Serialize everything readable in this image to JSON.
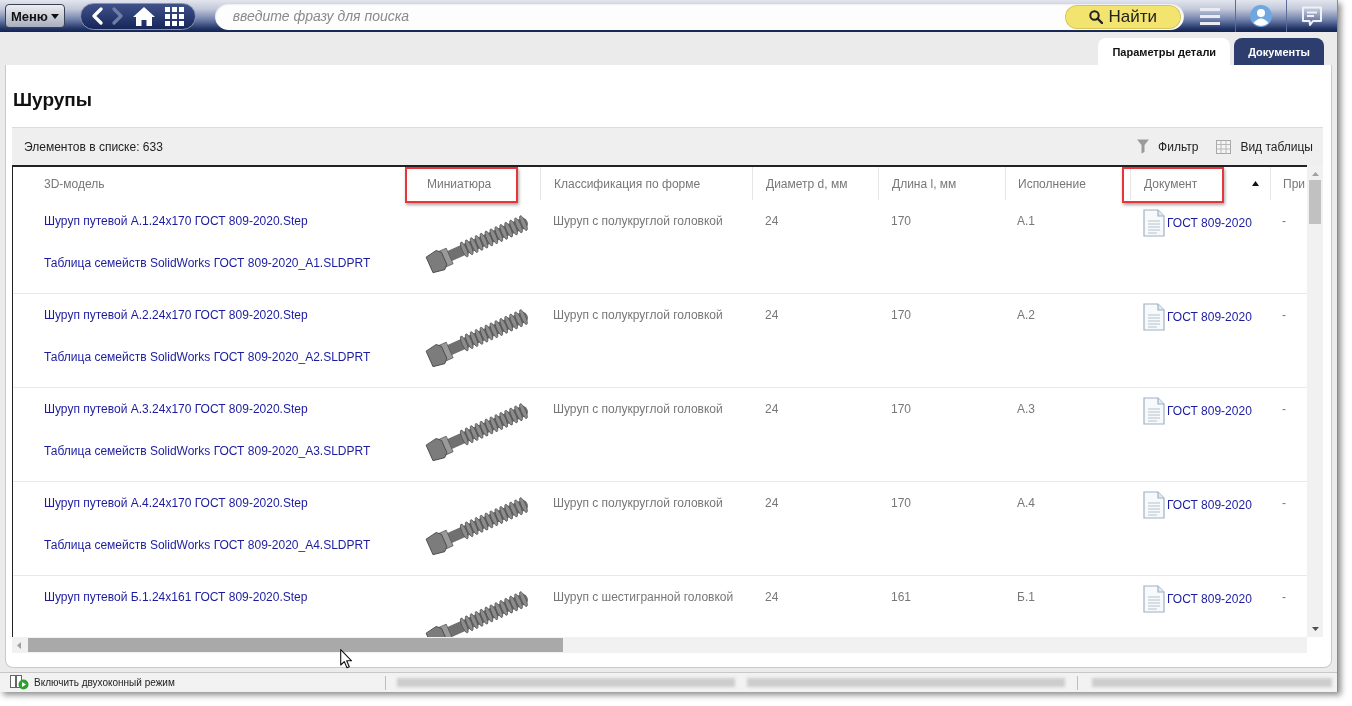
{
  "top_bar": {
    "menu_label": "Меню",
    "nav_buttons": [
      {
        "kind": "back",
        "disabled": false
      },
      {
        "kind": "forward",
        "disabled": true
      },
      {
        "kind": "home",
        "disabled": false
      },
      {
        "kind": "apps",
        "disabled": false
      }
    ],
    "search": {
      "placeholder": "введите фразу для поиска",
      "button_label": "Найти"
    }
  },
  "tabs": [
    {
      "label": "Параметры детали",
      "selected": true
    },
    {
      "label": "Документы",
      "selected": false
    }
  ],
  "page_title": "Шурупы",
  "toolbar": {
    "count": "Элементов в списке: 633",
    "actions": [
      {
        "kind": "filter",
        "label": "Фильтр"
      },
      {
        "kind": "table_view",
        "label": "Вид таблицы"
      }
    ]
  },
  "table": {
    "columns": [
      {
        "label": "3D-модель",
        "highlighted": false,
        "sorted": false
      },
      {
        "label": "Миниатюра",
        "highlighted": true,
        "sorted": false
      },
      {
        "label": "Классификация по форме",
        "highlighted": false,
        "sorted": false
      },
      {
        "label": "Диаметр d, мм",
        "highlighted": false,
        "sorted": false
      },
      {
        "label": "Длина l, мм",
        "highlighted": false,
        "sorted": false
      },
      {
        "label": "Исполнение",
        "highlighted": false,
        "sorted": false
      },
      {
        "label": "Документ",
        "highlighted": true,
        "sorted": true
      },
      {
        "label": "При",
        "highlighted": false,
        "sorted": false
      }
    ],
    "rows": [
      {
        "files": [
          "Шуруп путевой А.1.24x170 ГОСТ 809-2020.Step",
          "Таблица семейств SolidWorks ГОСТ 809-2020_А1.SLDPRT"
        ],
        "classification": "Шуруп с полукруглой головкой",
        "diameter": "24",
        "length": "170",
        "execution": "А.1",
        "document": "ГОСТ 809-2020",
        "column_8": "-"
      },
      {
        "files": [
          "Шуруп путевой А.2.24x170 ГОСТ 809-2020.Step",
          "Таблица семейств SolidWorks ГОСТ 809-2020_А2.SLDPRT"
        ],
        "classification": "Шуруп с полукруглой головкой",
        "diameter": "24",
        "length": "170",
        "execution": "А.2",
        "document": "ГОСТ 809-2020",
        "column_8": "-"
      },
      {
        "files": [
          "Шуруп путевой А.3.24x170 ГОСТ 809-2020.Step",
          "Таблица семейств SolidWorks ГОСТ 809-2020_А3.SLDPRT"
        ],
        "classification": "Шуруп с полукруглой головкой",
        "diameter": "24",
        "length": "170",
        "execution": "А.3",
        "document": "ГОСТ 809-2020",
        "column_8": "-"
      },
      {
        "files": [
          "Шуруп путевой А.4.24x170 ГОСТ 809-2020.Step",
          "Таблица семейств SolidWorks ГОСТ 809-2020_А4.SLDPRT"
        ],
        "classification": "Шуруп с полукруглой головкой",
        "diameter": "24",
        "length": "170",
        "execution": "А.4",
        "document": "ГОСТ 809-2020",
        "column_8": "-"
      },
      {
        "files": [
          "Шуруп путевой Б.1.24x161 ГОСТ 809-2020.Step"
        ],
        "classification": "Шуруп с шестигранной головкой",
        "diameter": "24",
        "length": "161",
        "execution": "Б.1",
        "document": "ГОСТ 809-2020",
        "column_8": "-"
      }
    ]
  },
  "status_bar": {
    "two_pane_label": "Включить двухоконный режим"
  }
}
